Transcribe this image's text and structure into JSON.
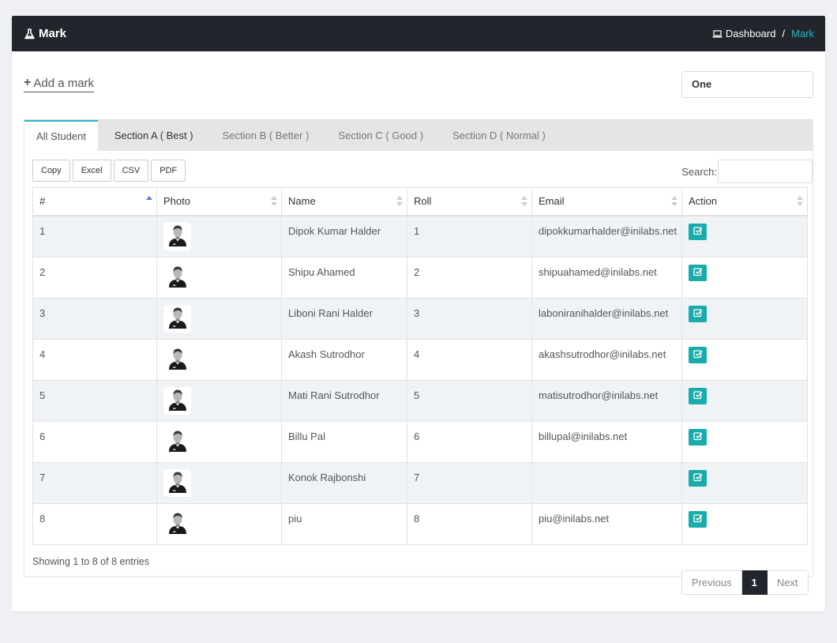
{
  "header": {
    "title": "Mark",
    "icon": "flask-icon",
    "breadcrumb": {
      "home": "Dashboard",
      "separator": "/",
      "current": "Mark"
    }
  },
  "add_mark": {
    "label": "Add a mark"
  },
  "class_select": {
    "value": "One"
  },
  "tabs": [
    {
      "label": "All Student",
      "active": true
    },
    {
      "label": "Section A ( Best )"
    },
    {
      "label": "Section B ( Better )"
    },
    {
      "label": "Section C ( Good )"
    },
    {
      "label": "Section D ( Normal )"
    }
  ],
  "export_buttons": {
    "copy": "Copy",
    "excel": "Excel",
    "csv": "CSV",
    "pdf": "PDF"
  },
  "search": {
    "label": "Search:",
    "value": ""
  },
  "table": {
    "columns": [
      "#",
      "Photo",
      "Name",
      "Roll",
      "Email",
      "Action"
    ],
    "rows": [
      {
        "num": "1",
        "name": "Dipok Kumar Halder",
        "roll": "1",
        "email": "dipokkumarhalder@inilabs.net"
      },
      {
        "num": "2",
        "name": "Shipu Ahamed",
        "roll": "2",
        "email": "shipuahamed@inilabs.net"
      },
      {
        "num": "3",
        "name": "Liboni Rani Halder",
        "roll": "3",
        "email": "laboniranihalder@inilabs.net"
      },
      {
        "num": "4",
        "name": "Akash Sutrodhor",
        "roll": "4",
        "email": "akashsutrodhor@inilabs.net"
      },
      {
        "num": "5",
        "name": "Mati Rani Sutrodhor",
        "roll": "5",
        "email": "matisutrodhor@inilabs.net"
      },
      {
        "num": "6",
        "name": "Billu Pal",
        "roll": "6",
        "email": "billupal@inilabs.net"
      },
      {
        "num": "7",
        "name": "Konok Rajbonshi",
        "roll": "7",
        "email": ""
      },
      {
        "num": "8",
        "name": "piu",
        "roll": "8",
        "email": "piu@inilabs.net"
      }
    ]
  },
  "info": "Showing 1 to 8 of 8 entries",
  "pagination": {
    "previous": "Previous",
    "current": "1",
    "next": "Next"
  },
  "colors": {
    "header_bg": "#22262c",
    "accent": "#2bb5c4",
    "action_btn": "#1aacac"
  }
}
